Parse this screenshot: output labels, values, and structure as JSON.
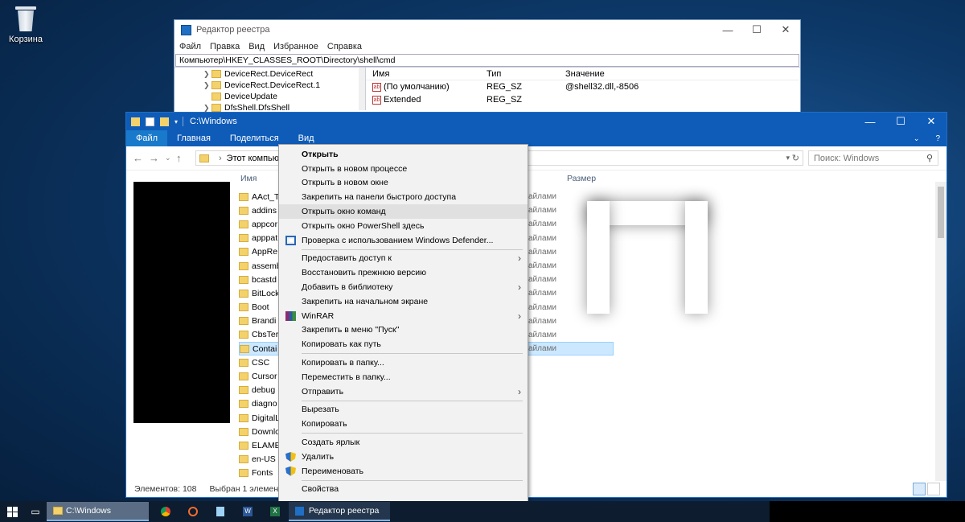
{
  "desktop": {
    "recycle_bin_label": "Корзина"
  },
  "regedit": {
    "title": "Редактор реестра",
    "menu": [
      "Файл",
      "Правка",
      "Вид",
      "Избранное",
      "Справка"
    ],
    "address": "Компьютер\\HKEY_CLASSES_ROOT\\Directory\\shell\\cmd",
    "tree": [
      "DeviceRect.DeviceRect",
      "DeviceRect.DeviceRect.1",
      "DeviceUpdate",
      "DfsShell.DfsShell"
    ],
    "columns": [
      "Имя",
      "Тип",
      "Значение"
    ],
    "rows": [
      {
        "name": "(По умолчанию)",
        "type": "REG_SZ",
        "value": "@shell32.dll,-8506"
      },
      {
        "name": "Extended",
        "type": "REG_SZ",
        "value": ""
      }
    ]
  },
  "explorer": {
    "title": "C:\\Windows",
    "ribbon_tabs": [
      "Файл",
      "Главная",
      "Поделиться",
      "Вид"
    ],
    "address_root": "Этот компьютер",
    "search_placeholder": "Поиск: Windows",
    "col_name": "Имя",
    "col_size": "Размер",
    "files": [
      "AAct_T",
      "addins",
      "appcor",
      "apppat",
      "AppRe",
      "assemb",
      "bcastd",
      "BitLock",
      "Boot",
      "Brandi",
      "CbsTer",
      "Contai",
      "CSC",
      "Cursor",
      "debug",
      "diagno",
      "DigitalL",
      "Downlo",
      "ELAME",
      "en-US",
      "Fonts"
    ],
    "selected_index": 11,
    "type_text": "айлами",
    "status_items": "Элементов: 108",
    "status_selected": "Выбран 1 элемент"
  },
  "context_menu": {
    "items": [
      {
        "label": "Открыть",
        "bold": true
      },
      {
        "label": "Открыть в новом процессе"
      },
      {
        "label": "Открыть в новом окне"
      },
      {
        "label": "Закрепить на панели быстрого доступа"
      },
      {
        "label": "Открыть окно команд",
        "hover": true
      },
      {
        "label": "Открыть окно PowerShell здесь"
      },
      {
        "label": "Проверка с использованием Windows Defender...",
        "icon": "defender-icon"
      },
      {
        "separator": true
      },
      {
        "label": "Предоставить доступ к",
        "submenu": true
      },
      {
        "label": "Восстановить прежнюю версию"
      },
      {
        "label": "Добавить в библиотеку",
        "submenu": true
      },
      {
        "label": "Закрепить на начальном экране"
      },
      {
        "label": "WinRAR",
        "icon": "winrar-icon",
        "submenu": true
      },
      {
        "label": "Закрепить в меню \"Пуск\""
      },
      {
        "label": "Копировать как путь"
      },
      {
        "separator": true
      },
      {
        "label": "Копировать в папку..."
      },
      {
        "label": "Переместить в папку..."
      },
      {
        "label": "Отправить",
        "submenu": true
      },
      {
        "separator": true
      },
      {
        "label": "Вырезать"
      },
      {
        "label": "Копировать"
      },
      {
        "separator": true
      },
      {
        "label": "Создать ярлык"
      },
      {
        "label": "Удалить",
        "icon": "shield-icon"
      },
      {
        "label": "Переименовать",
        "icon": "shield-icon"
      },
      {
        "separator": true
      },
      {
        "label": "Свойства"
      }
    ]
  },
  "taskbar": {
    "explorer_label": "C:\\Windows",
    "regedit_label": "Редактор реестра"
  },
  "colors": {
    "titlebar": "#0f5cb8",
    "selection": "#cce8ff",
    "taskbar": "#0d1c2e"
  }
}
